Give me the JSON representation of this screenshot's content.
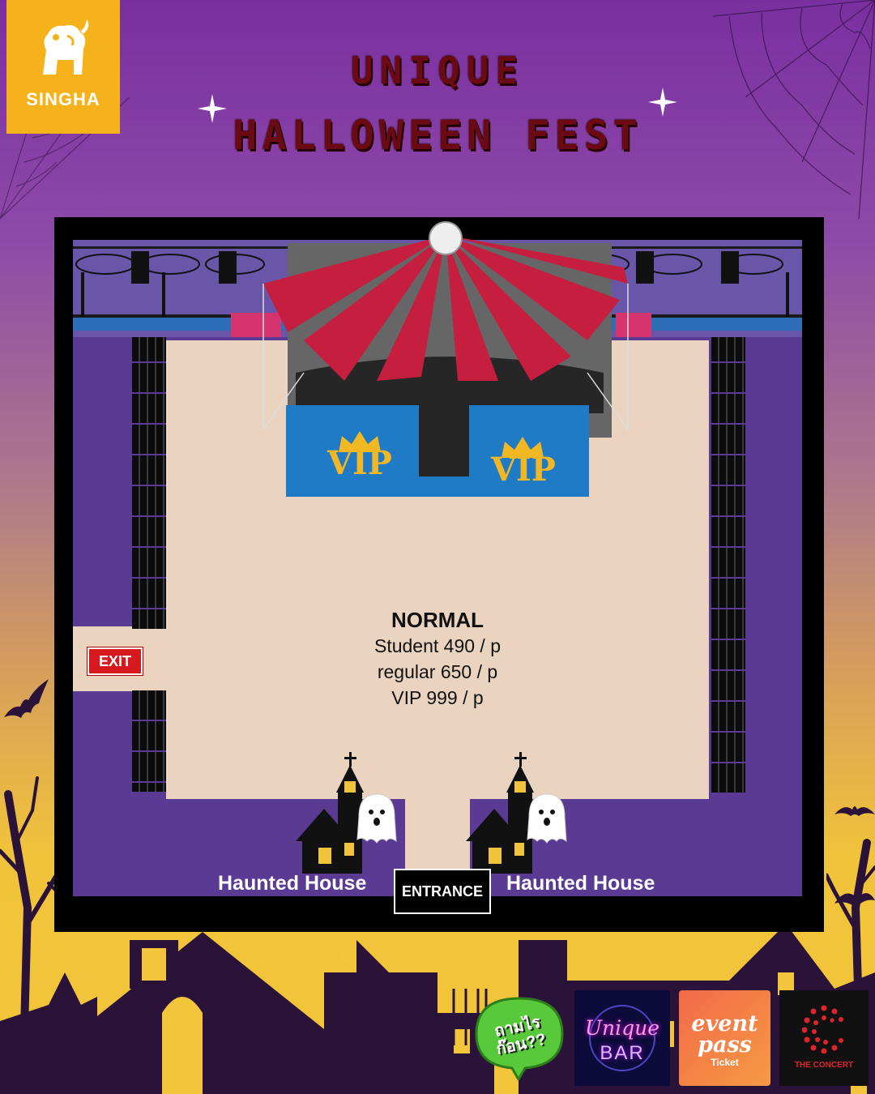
{
  "brand": {
    "logo_text": "SINGHA",
    "logo_color": "#f6b21a"
  },
  "title": {
    "line1": "UNIQUE",
    "line2": "HALLOWEEN FEST",
    "color": "#6b0a12"
  },
  "map": {
    "vip_label_left": "VIP",
    "vip_label_right": "VIP",
    "pricing": {
      "title": "NORMAL",
      "student": "Student 490 / p",
      "regular": "regular 650 / p",
      "vip": "VIP 999 / p"
    },
    "exit_label": "EXIT",
    "entrance_label": "ENTRANCE",
    "haunted_left": "Haunted House",
    "haunted_right": "Haunted House",
    "colors": {
      "floor": "#ead3bf",
      "surround": "#5b3a94",
      "vip_zone": "#1f7bc6",
      "exit": "#d7191f"
    }
  },
  "sponsors": {
    "kaolai": "ถามไร ก๊อน??",
    "unique_bar_line1": "Unique",
    "unique_bar_line2": "BAR",
    "eventpass_line1": "event",
    "eventpass_line2": "pass",
    "eventpass_sub": "Ticket",
    "concert": "THE CONCERT"
  },
  "icons": [
    "lion-emblem-icon",
    "sparkle-icon",
    "spiderweb-icon",
    "bat-icon",
    "ghost-icon",
    "haunted-house-icon",
    "crown-icon",
    "speaker-icon",
    "spotlight-icon"
  ]
}
